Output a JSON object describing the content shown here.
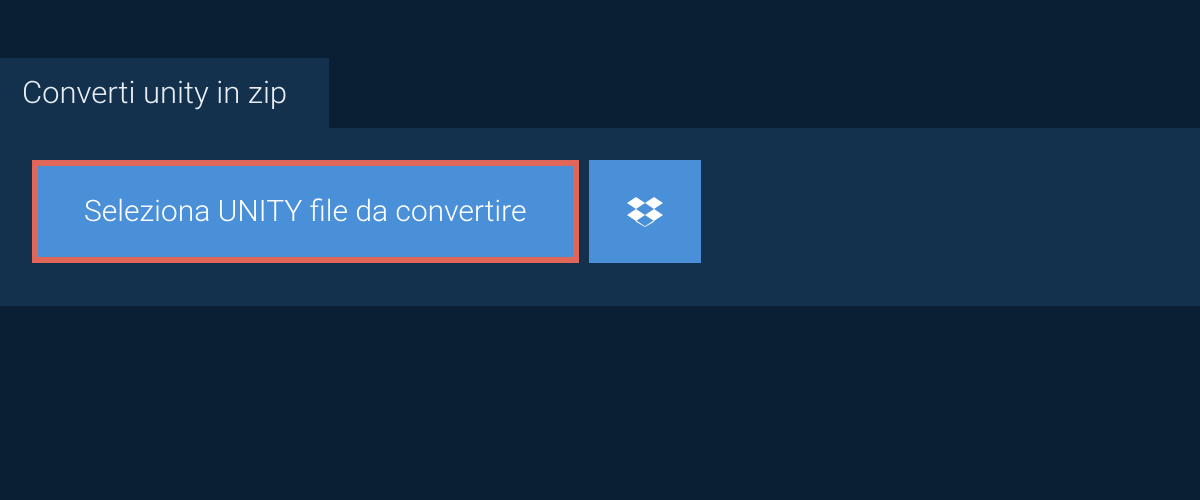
{
  "tab": {
    "title": "Converti unity in zip"
  },
  "actions": {
    "select_file_label": "Seleziona UNITY file da convertire",
    "dropbox_icon": "dropbox-icon"
  },
  "colors": {
    "page_bg": "#0a1f33",
    "panel_bg": "#13304d",
    "button_bg": "#4a90d9",
    "highlight_border": "#e06659",
    "text_light": "#ffffff"
  }
}
